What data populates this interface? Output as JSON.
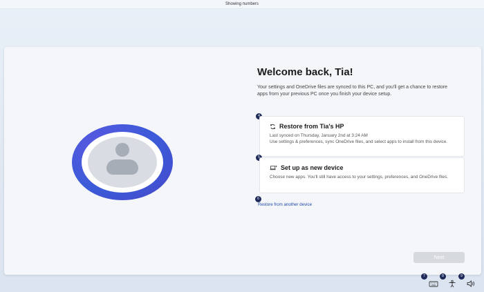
{
  "topbar": {
    "title": "Showing numbers"
  },
  "page": {
    "title": "Welcome back, Tia!",
    "description": "Your settings and OneDrive files are synced to this PC, and you'll get a chance to restore apps from your previous PC once you finish your device setup."
  },
  "options": [
    {
      "badge": "4",
      "title": "Restore from Tia's HP",
      "line1": "Last synced on Thursday, January 2nd at 3:24 AM",
      "line2": "Use settings & preferences, sync OneDrive files, and select apps to install from this device.",
      "icon": "sync-icon"
    },
    {
      "badge": "5",
      "title": "Set up as new device",
      "line1": "Choose new apps. You'll still have access to your settings, preferences, and OneDrive files.",
      "icon": "laptop-sparkle-icon"
    }
  ],
  "restore_link": {
    "badge": "6",
    "label": "Restore from another device"
  },
  "next_button": {
    "label": "Next"
  },
  "system_tray": [
    {
      "badge": "7",
      "icon": "keyboard-icon"
    },
    {
      "badge": "8",
      "icon": "accessibility-icon"
    },
    {
      "badge": "9",
      "icon": "volume-icon"
    }
  ],
  "colors": {
    "accent_ring": "#3b5bd8",
    "badge": "#1e2a5a",
    "link": "#1f4aa8",
    "button_disabled": "#d6d9de"
  }
}
